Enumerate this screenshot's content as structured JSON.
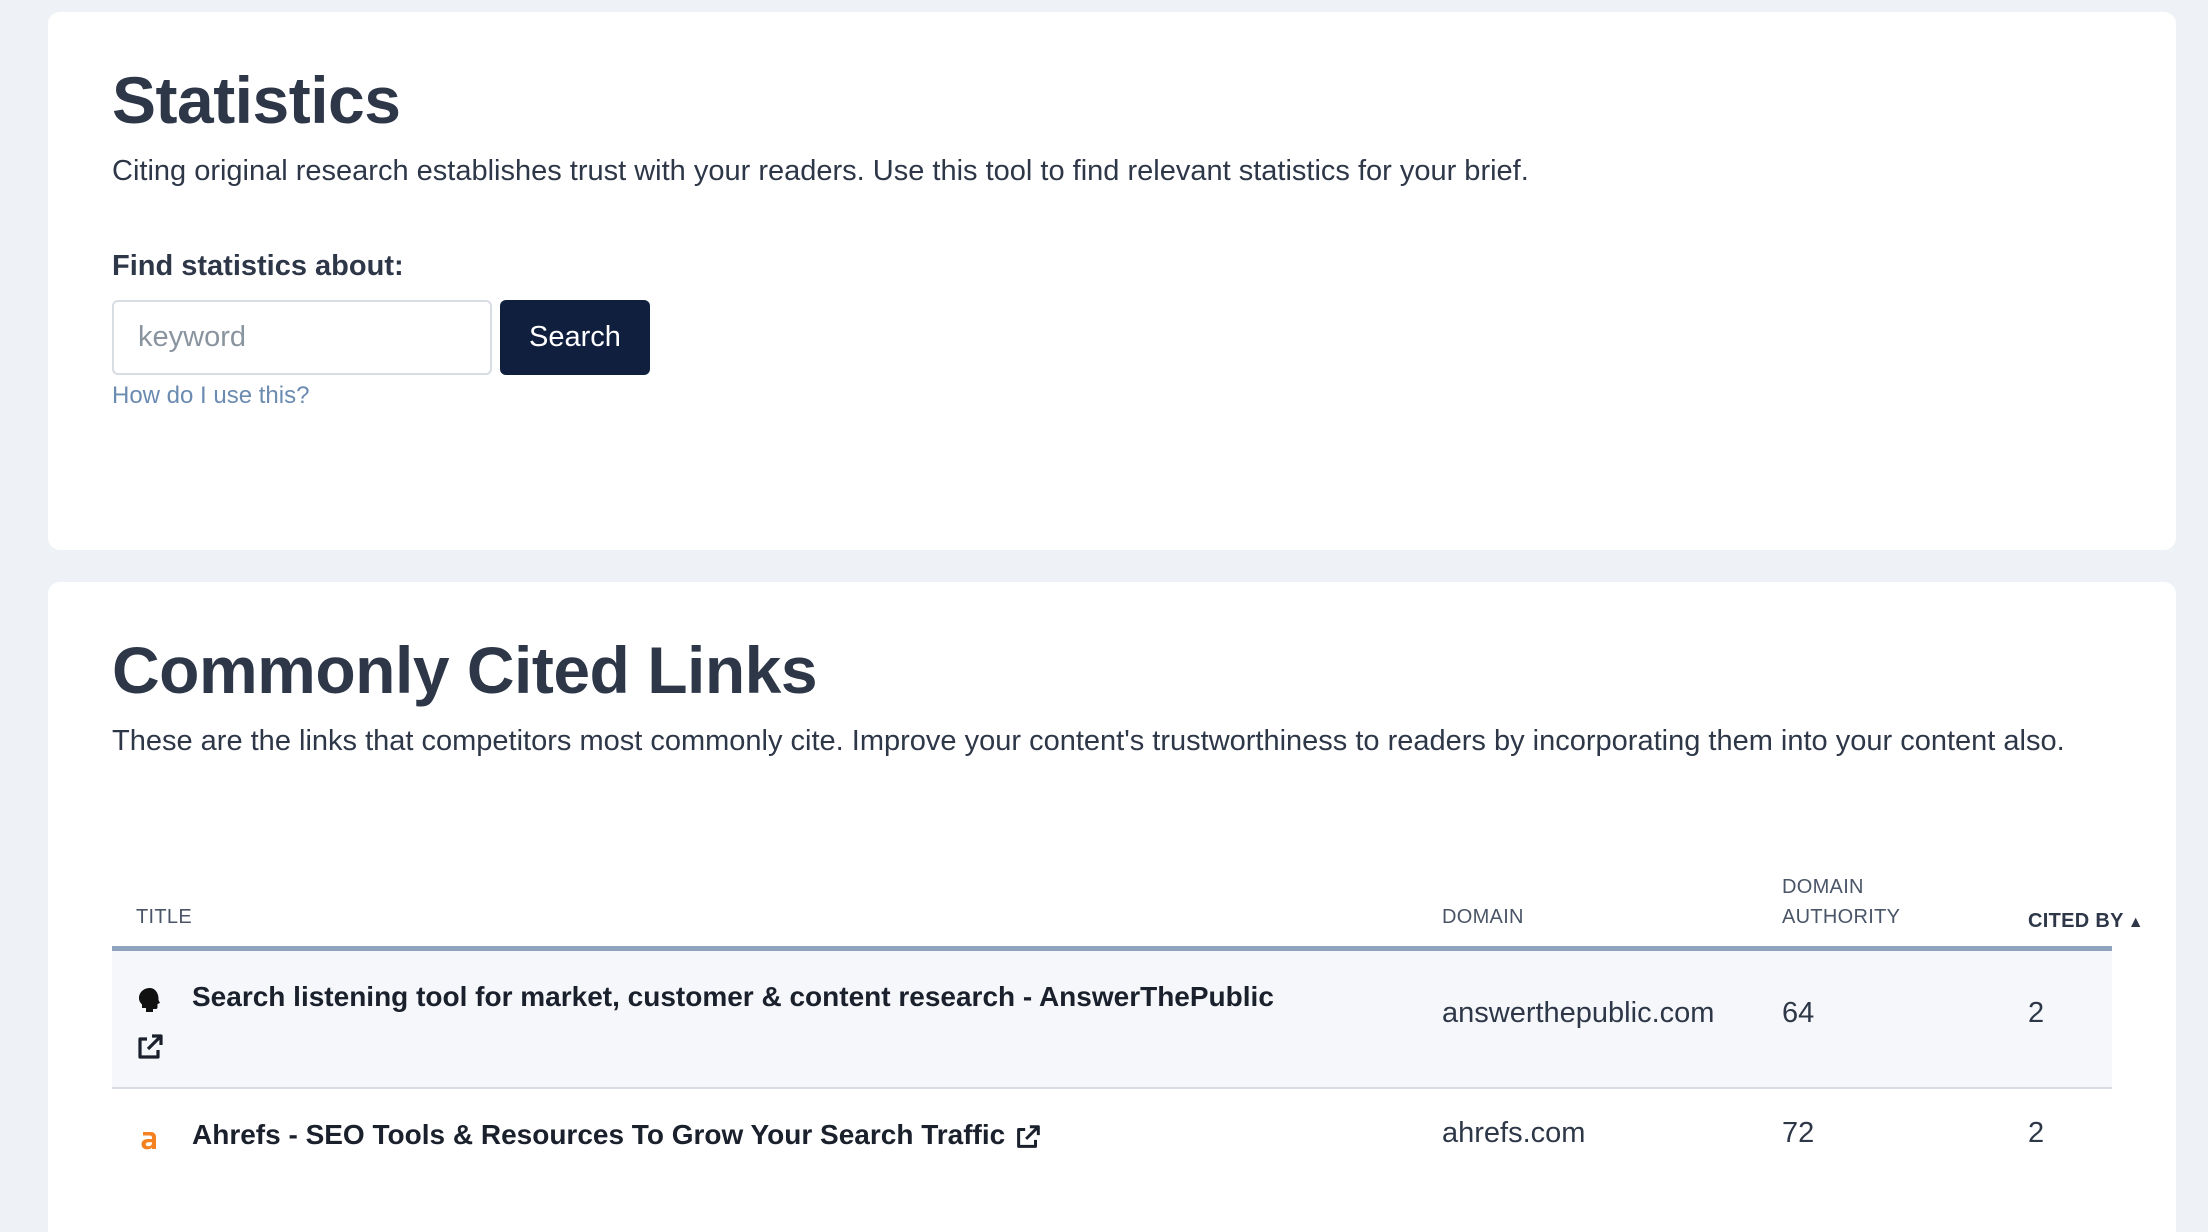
{
  "statistics": {
    "title": "Statistics",
    "description": "Citing original research establishes trust with your readers. Use this tool to find relevant statistics for your brief.",
    "find_label": "Find statistics about:",
    "search_placeholder": "keyword",
    "search_button": "Search",
    "help_link": "How do I use this?"
  },
  "links": {
    "title": "Commonly Cited Links",
    "description": "These are the links that competitors most commonly cite. Improve your content's trustworthiness to readers by incorporating them into your content also.",
    "columns": {
      "title": "Title",
      "domain": "Domain",
      "domain_authority": "Domain Authority",
      "cited_by": "Cited By"
    },
    "rows": [
      {
        "favicon": "answerthepublic-head-icon",
        "title": "Search listening tool for market, customer & content research - AnswerThePublic",
        "domain": "answerthepublic.com",
        "domain_authority": "64",
        "cited_by": "2"
      },
      {
        "favicon": "ahrefs-logo-icon",
        "title": "Ahrefs - SEO Tools & Resources To Grow Your Search Traffic",
        "domain": "ahrefs.com",
        "domain_authority": "72",
        "cited_by": "2"
      }
    ]
  },
  "colors": {
    "background": "#eef1f5",
    "card": "#ffffff",
    "primary_button": "#0f1f3d",
    "link": "#6b8bb0",
    "header_rule": "#8ea3bd",
    "ahrefs_orange": "#f58220"
  }
}
